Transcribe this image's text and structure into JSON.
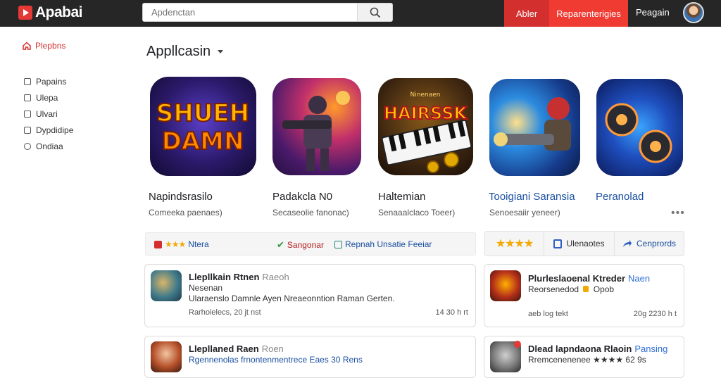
{
  "header": {
    "logo_text": "Apabai",
    "search_placeholder": "Apdenctan",
    "button_primary": "Abler",
    "button_secondary": "Reparenterigies",
    "profile_label": "Peagain"
  },
  "sidebar": {
    "home_label": "Plepbns",
    "items": [
      {
        "label": "Papains",
        "icon": "square-icon"
      },
      {
        "label": "Ulepa",
        "icon": "square-icon"
      },
      {
        "label": "Ulvari",
        "icon": "square-icon"
      },
      {
        "label": "Dypdidipe",
        "icon": "square-icon"
      },
      {
        "label": "Ondiaa",
        "icon": "circle-icon"
      }
    ]
  },
  "section": {
    "title": "Appllcasin"
  },
  "apps": [
    {
      "name": "Napindsrasilo",
      "subtitle": "Comeeka paenaes)",
      "icon_text": [
        "SHUEH",
        "DAMN"
      ]
    },
    {
      "name": "Padakcla N0",
      "subtitle": "Secaseolie fanonac)"
    },
    {
      "name": "Haltemian",
      "subtitle": "Senaaalclaco Toeer)",
      "icon_text": [
        "Ninenaen",
        "HAIRSSK"
      ]
    },
    {
      "name": "Tooigiani Saransia",
      "subtitle": "Senoesaiir yeneer)"
    },
    {
      "name": "Peranolad",
      "subtitle": ""
    }
  ],
  "filters": [
    {
      "label": "Ntera",
      "icon": "star-rating-icon",
      "stars": "★★★"
    },
    {
      "label": "Sangonar",
      "icon": "check-icon",
      "mark": "✔"
    },
    {
      "label": "Repnah Unsatie Feeiar",
      "icon": "info-box-icon"
    }
  ],
  "actions": [
    {
      "label": "",
      "icon": "stars-icon",
      "stars": "★★★★"
    },
    {
      "label": "Ulenaotes",
      "icon": "document-icon"
    },
    {
      "label": "Cenprords",
      "icon": "share-arrow-icon"
    }
  ],
  "more_label": "•••",
  "cards": [
    {
      "title": "Llepllkain Rtnen",
      "tag": "Raeoh",
      "line2": "Nesenan",
      "line3": "Ularaenslo Damnle Ayen Nreaeonntion Raman Gerten.",
      "meta": "Rarhoielecs, 20 jt nst",
      "count": "14 30 h rt"
    },
    {
      "title": "Plurleslaoenal Ktreder",
      "tag": "Naen",
      "line2": "Reorsenedod",
      "line2_extra": "Opob",
      "line3": "",
      "meta": "aeb log tekt",
      "count": "20g 2230 h t"
    },
    {
      "title": "Llepllaned Raen",
      "tag": "Roen",
      "line2": "Rgennenolas frnontenmentrece Eaes 30 Rens",
      "meta": "",
      "count": ""
    },
    {
      "title": "Dlead lapndaona Rlaoin",
      "tag": "Pansing",
      "line2": "Rremcenenenee ★★★★ 62 9s",
      "meta": "",
      "count": ""
    }
  ]
}
